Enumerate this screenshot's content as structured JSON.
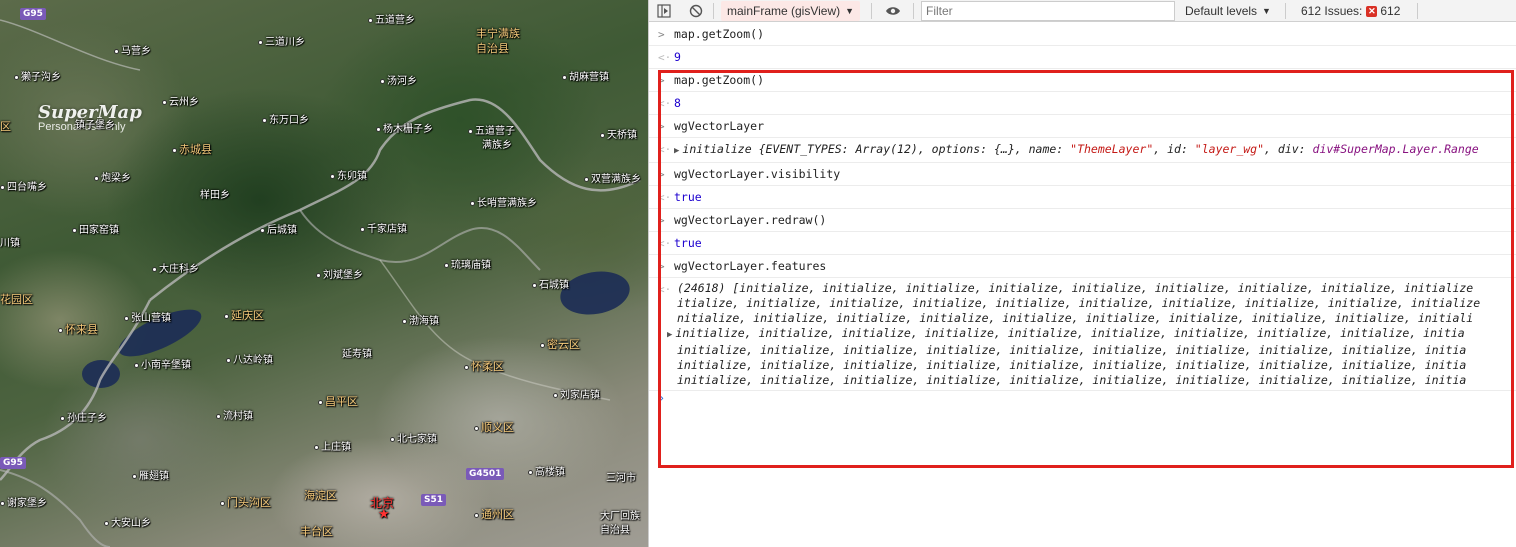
{
  "map": {
    "watermark_title": "SuperMap",
    "watermark_subtitle": "Personal use only",
    "shields": [
      "G95",
      "G95",
      "S51",
      "G4501"
    ],
    "labels": {
      "wudaoying": "五道营乡",
      "fengning": "丰宁满族",
      "fengning2": "自治县",
      "mayingxiang": "马营乡",
      "sandaochuan": "三道川乡",
      "tangzigou": "獭子沟乡",
      "tanghe": "汤河乡",
      "humaying": "胡麻营镇",
      "yunzhou": "云州乡",
      "dongwankou": "东万口乡",
      "duishi": "镇子堡乡",
      "yangmuzhazi": "杨木栅子乡",
      "wudaoyingzi": "五道营子",
      "wudaoyingzi2": "满族乡",
      "tianqiao": "天桥镇",
      "chicheng": "赤城县",
      "qu_left": "区",
      "paoliang": "炮梁乡",
      "dongmao": "东卯镇",
      "shuangyingzi": "双营满族乡",
      "sitaizui": "四台嘴乡",
      "yangtian": "样田乡",
      "changshaoying": "长哨营满族乡",
      "tianjiaying": "田家窑镇",
      "houcheng": "后城镇",
      "qianjiadian": "千家店镇",
      "chuan": "川镇",
      "dazhuangke": "大庄科乡",
      "liubinbao": "刘斌堡乡",
      "liulimiao": "琉璃庙镇",
      "shicheng": "石城镇",
      "huahuaqu": "花园区",
      "zhangshanying": "张山营镇",
      "yanqing": "延庆区",
      "huailai": "怀来县",
      "bohai": "渤海镇",
      "miyun": "密云区",
      "xiaonanxinbao": "小南辛堡镇",
      "badaling": "八达岭镇",
      "yanshou": "延寿镇",
      "huairou": "怀柔区",
      "changping": "昌平区",
      "liujiadian": "刘家店镇",
      "sunzhuang": "孙庄子乡",
      "liucun": "流村镇",
      "shunyi": "顺义区",
      "shangzhuang": "上庄镇",
      "beiqijia": "北七家镇",
      "yanchi": "雁翅镇",
      "gaolou": "高楼镇",
      "sanhe": "三河市",
      "xiejiabu": "谢家堡乡",
      "mentougou": "门头沟区",
      "haidian": "海淀区",
      "beijing": "北京",
      "tongzhou": "通州区",
      "daan": "大安山乡",
      "dachang": "大厂回族",
      "dachang2": "自治县",
      "fengtai": "丰台区"
    }
  },
  "devtools": {
    "toolbar": {
      "frame_label": "mainFrame (gisView)",
      "filter_placeholder": "Filter",
      "levels_label": "Default levels",
      "issues_label": "612 Issues:",
      "issues_count": "612"
    },
    "entries": [
      {
        "command": "map.getZoom()",
        "result": "9"
      },
      {
        "command": "map.getZoom()",
        "result": "8"
      },
      {
        "command": "wgVectorLayer",
        "result_prefix": "initialize {EVENT_TYPES: Array(12), options: {…}, name: ",
        "result_name": "\"ThemeLayer\"",
        "result_mid": ", id: ",
        "result_id": "\"layer_wg\"",
        "result_mid2": ", div: ",
        "result_div": "div#SuperMap.Layer.Range"
      },
      {
        "command": "wgVectorLayer.visibility",
        "result": "true"
      },
      {
        "command": "wgVectorLayer.redraw()",
        "result": "true"
      },
      {
        "command": "wgVectorLayer.features",
        "result_lines": [
          "(24618) [initialize, initialize, initialize, initialize, initialize, initialize, initialize, initialize, initialize",
          "itialize, initialize, initialize, initialize, initialize, initialize, initialize, initialize, initialize, initialize",
          "nitialize, initialize, initialize, initialize, initialize, initialize, initialize, initialize, initialize, initiali",
          "initialize, initialize, initialize, initialize, initialize, initialize, initialize, initialize, initialize, initia",
          "initialize, initialize, initialize, initialize, initialize, initialize, initialize, initialize, initialize, initia",
          "initialize, initialize, initialize, initialize, initialize, initialize, initialize, initialize, initialize, initia",
          "initialize, initialize, initialize, initialize, initialize, initialize, initialize, initialize, initialize, initia"
        ]
      }
    ],
    "highlight_color": "#e0201c"
  }
}
